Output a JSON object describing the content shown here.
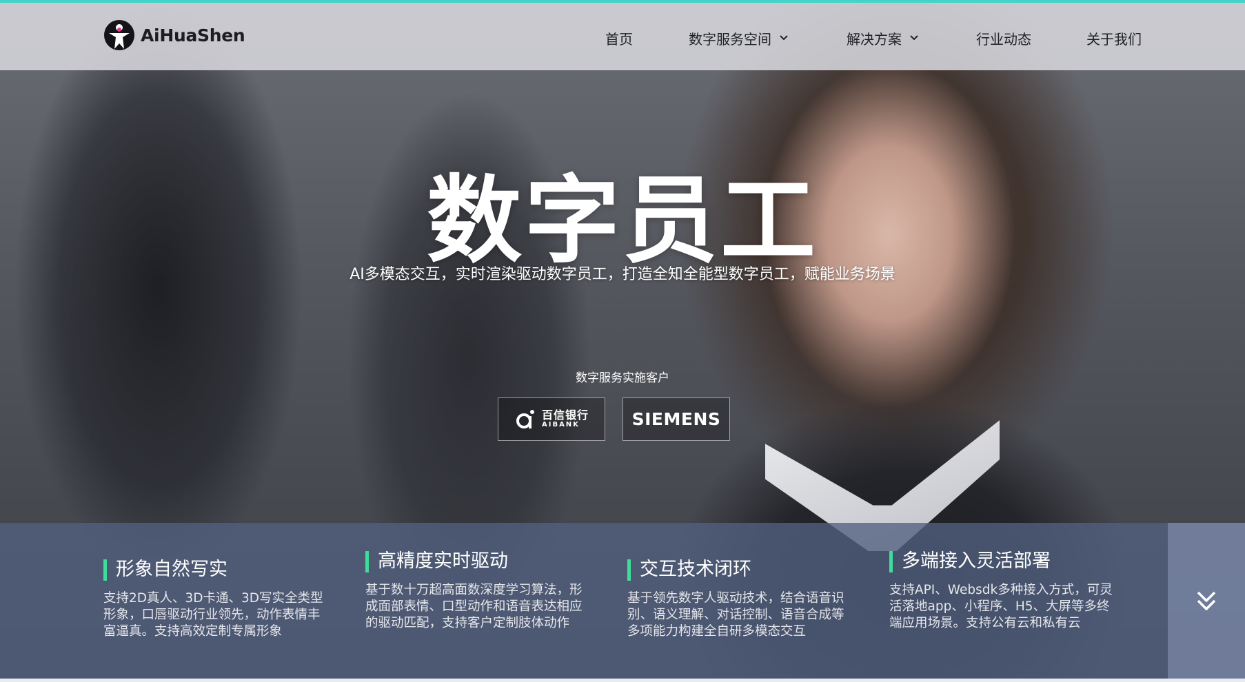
{
  "brand": {
    "name": "AiHuaShen",
    "accent": "#3fdc9a",
    "top_accent": "#3fd6c8"
  },
  "nav": {
    "home": "首页",
    "space": "数字服务空间",
    "solution": "解决方案",
    "news": "行业动态",
    "about": "关于我们"
  },
  "hero": {
    "title": "数字员工",
    "subtitle": "AI多模态交互，实时渲染驱动数字员工，打造全知全能型数字员工，赋能业务场景",
    "clients_label": "数字服务实施客户",
    "clients": [
      {
        "cn": "百信银行",
        "en": "AIBANK"
      },
      {
        "name": "SIEMENS"
      }
    ]
  },
  "features": [
    {
      "title": "形象自然写实",
      "desc": "支持2D真人、3D卡通、3D写实全类型形象，口唇驱动行业领先，动作表情丰富逼真。支持高效定制专属形象"
    },
    {
      "title": "高精度实时驱动",
      "desc": "基于数十万超高面数深度学习算法，形成面部表情、口型动作和语音表达相应的驱动匹配，支持客户定制肢体动作"
    },
    {
      "title": "交互技术闭环",
      "desc": "基于领先数字人驱动技术，结合语音识别、语义理解、对话控制、语音合成等多项能力构建全自研多模态交互"
    },
    {
      "title": "多端接入灵活部署",
      "desc": "支持API、Websdk多种接入方式，可灵活落地app、小程序、H5、大屏等多终端应用场景。支持公有云和私有云"
    }
  ],
  "icons": {
    "logo": "person-logo-icon",
    "dropdown": "chevron-down-icon",
    "scroll": "double-chevron-down-icon"
  }
}
